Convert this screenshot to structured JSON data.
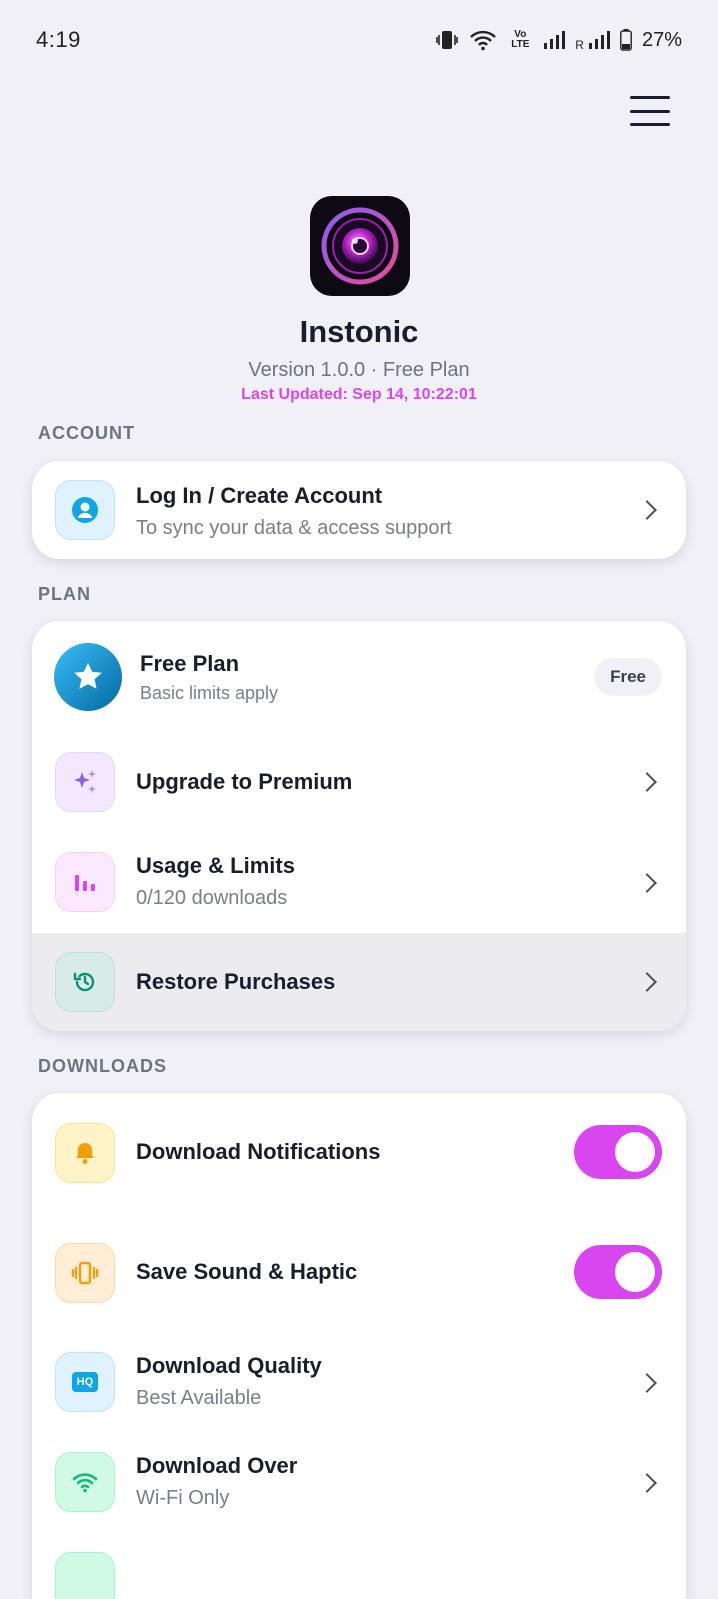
{
  "status_bar": {
    "time": "4:19",
    "battery": "27%",
    "network_label": "Vo LTE",
    "roaming": "R"
  },
  "header": {
    "app_name": "Instonic",
    "version": "Version 1.0.0 · Free Plan",
    "last_updated": "Last Updated: Sep 14, 10:22:01"
  },
  "sections": {
    "account": "ACCOUNT",
    "plan": "PLAN",
    "downloads": "DOWNLOADS"
  },
  "account": {
    "login_title": "Log In / Create Account",
    "login_sub": "To sync your data & access support"
  },
  "plan": {
    "free_title": "Free Plan",
    "free_sub": "Basic limits apply",
    "free_badge": "Free",
    "upgrade_title": "Upgrade to Premium",
    "usage_title": "Usage & Limits",
    "usage_sub": "0/120 downloads",
    "restore_title": "Restore Purchases"
  },
  "downloads": {
    "notifications_title": "Download Notifications",
    "notifications_on": true,
    "sound_title": "Save Sound & Haptic",
    "sound_on": true,
    "quality_title": "Download Quality",
    "quality_sub": "Best Available",
    "quality_icon_text": "HQ",
    "over_title": "Download Over",
    "over_sub": "Wi-Fi Only"
  },
  "colors": {
    "accent": "#d946ef",
    "background": "#f1f0f7",
    "text_primary": "#1b1c2e",
    "text_secondary": "#7a7e8d"
  },
  "icons": {
    "account": "user-circle-icon",
    "free_plan": "star-icon",
    "upgrade": "sparkles-icon",
    "usage": "bar-chart-icon",
    "restore": "history-icon",
    "notifications": "bell-icon",
    "sound": "vibrate-icon",
    "quality": "hq-icon",
    "over": "wifi-icon"
  }
}
